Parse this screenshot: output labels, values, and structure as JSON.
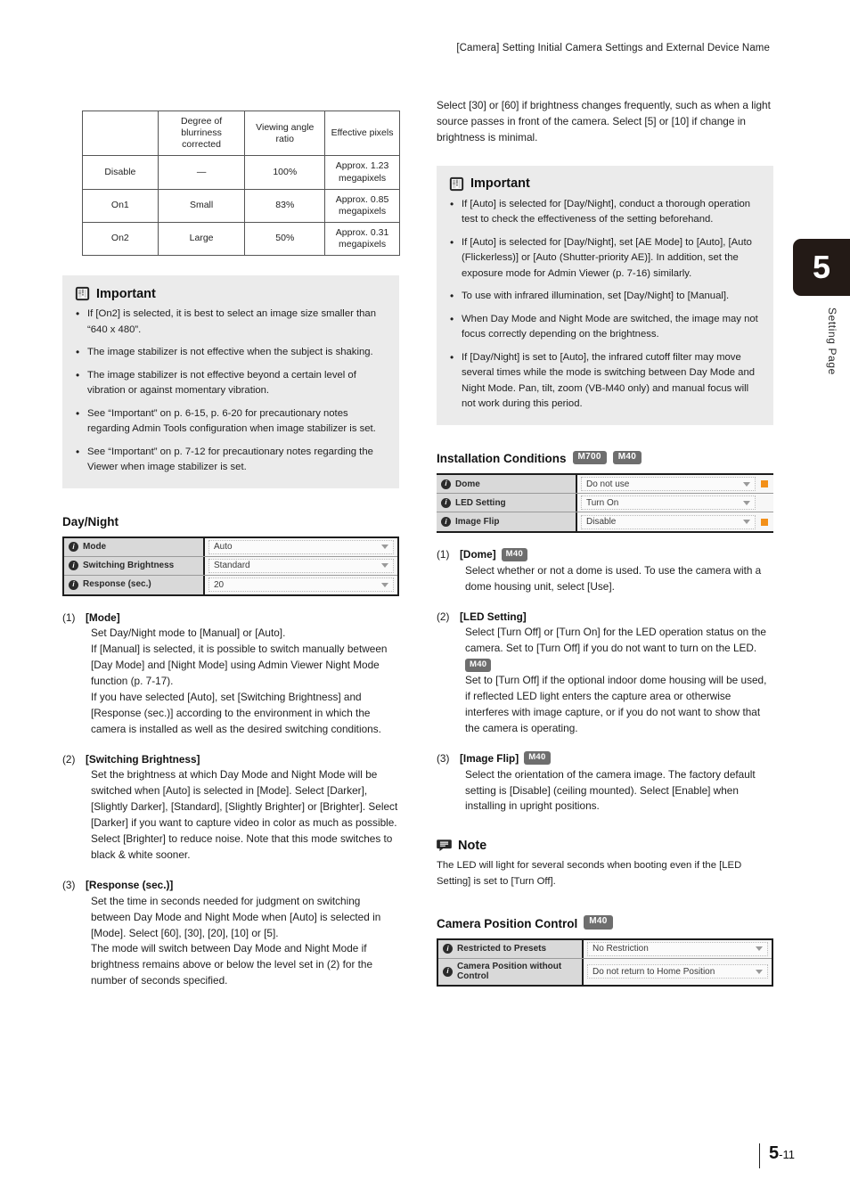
{
  "header": {
    "title": "[Camera] Setting Initial Camera Settings and External Device Name"
  },
  "side_tab": {
    "chapter": "5",
    "label": "Setting Page"
  },
  "footer": {
    "page_major": "5",
    "page_minor": "-11"
  },
  "left": {
    "spec_table": {
      "headers": [
        "",
        "Degree of blurriness corrected",
        "Viewing angle ratio",
        "Effective pixels"
      ],
      "rows": [
        [
          "Disable",
          "—",
          "100%",
          "Approx. 1.23 megapixels"
        ],
        [
          "On1",
          "Small",
          "83%",
          "Approx. 0.85 megapixels"
        ],
        [
          "On2",
          "Large",
          "50%",
          "Approx. 0.31 megapixels"
        ]
      ]
    },
    "important": {
      "title": "Important",
      "icon": "important-icon",
      "items": [
        "If [On2] is selected, it is best to select an image size smaller than “640 x 480”.",
        "The image stabilizer is not effective when the subject is shaking.",
        "The image stabilizer is not effective beyond a certain level of vibration or against momentary vibration.",
        "See “Important” on p. 6-15, p. 6-20 for precautionary notes regarding Admin Tools configuration when image stabilizer is set.",
        "See “Important” on p. 7-12 for precautionary notes regarding the Viewer when image stabilizer is set."
      ]
    },
    "daynight": {
      "heading": "Day/Night",
      "settings": [
        {
          "label": "Mode",
          "value": "Auto",
          "mark": false
        },
        {
          "label": "Switching Brightness",
          "value": "Standard",
          "mark": false
        },
        {
          "label": "Response (sec.)",
          "value": "20",
          "mark": false
        }
      ]
    },
    "items": [
      {
        "index": "(1)",
        "title": "[Mode]",
        "badge": "",
        "body": "Set Day/Night mode to [Manual] or [Auto].\nIf [Manual] is selected, it is possible to switch manually between [Day Mode] and [Night Mode] using Admin Viewer Night Mode function (p. 7-17).\nIf you have selected [Auto], set [Switching Brightness] and [Response (sec.)] according to the environment in which the camera is installed as well as the desired switching conditions."
      },
      {
        "index": "(2)",
        "title": "[Switching Brightness]",
        "badge": "",
        "body": "Set the brightness at which Day Mode and Night Mode will be switched when [Auto] is selected in [Mode]. Select [Darker], [Slightly Darker], [Standard], [Slightly Brighter] or [Brighter]. Select [Darker] if you want to capture video in color as much as possible. Select [Brighter] to reduce noise. Note that this mode switches to black & white sooner."
      },
      {
        "index": "(3)",
        "title": "[Response (sec.)]",
        "badge": "",
        "body": "Set the time in seconds needed for judgment on switching between Day Mode and Night Mode when [Auto] is selected in [Mode]. Select [60], [30], [20], [10] or [5].\nThe mode will switch between Day Mode and Night Mode if brightness remains above or below the level set in (2) for the number of seconds specified."
      }
    ]
  },
  "right": {
    "intro": "Select [30] or [60] if brightness changes frequently, such as when a light source passes in front of the camera. Select [5] or [10] if change in brightness is minimal.",
    "important": {
      "title": "Important",
      "icon": "important-icon",
      "items": [
        "If [Auto] is selected for [Day/Night], conduct a thorough operation test to check the effectiveness of the setting beforehand.",
        "If [Auto] is selected for [Day/Night], set [AE Mode] to [Auto], [Auto (Flickerless)] or [Auto (Shutter-priority AE)]. In addition, set the exposure mode for Admin Viewer (p. 7-16) similarly.",
        "To use with infrared illumination, set [Day/Night] to [Manual].",
        "When Day Mode and Night Mode are switched, the image may not focus correctly depending on the brightness.",
        "If [Day/Night] is set to [Auto], the infrared cutoff filter may move several times while the mode is switching between Day Mode and Night Mode. Pan, tilt, zoom (VB-M40 only) and manual focus will not work during this period."
      ]
    },
    "installation": {
      "heading": "Installation Conditions",
      "badges": [
        "M700",
        "M40"
      ],
      "settings": [
        {
          "label": "Dome",
          "value": "Do not use",
          "mark": true
        },
        {
          "label": "LED Setting",
          "value": "Turn On",
          "mark": false
        },
        {
          "label": "Image Flip",
          "value": "Disable",
          "mark": true
        }
      ]
    },
    "items": [
      {
        "index": "(1)",
        "title": "[Dome]",
        "badge": "M40",
        "body": "Select whether or not a dome is used. To use the camera with a dome housing unit, select [Use].",
        "sub_badge": "",
        "body2": ""
      },
      {
        "index": "(2)",
        "title": "[LED Setting]",
        "badge": "",
        "body": "Select [Turn Off] or [Turn On] for the LED operation status on the camera. Set to [Turn Off] if you do not want to turn on the LED.",
        "sub_badge": "M40",
        "body2": "Set to [Turn Off] if the optional indoor dome housing will be used, if reflected LED light enters the capture area or otherwise interferes with image capture, or if you do not want to show that the camera is operating."
      },
      {
        "index": "(3)",
        "title": "[Image Flip]",
        "badge": "M40",
        "body": "Select the orientation of the camera image. The factory default setting is [Disable] (ceiling mounted). Select [Enable] when installing in upright positions.",
        "sub_badge": "",
        "body2": ""
      }
    ],
    "note": {
      "title": "Note",
      "icon": "note-icon",
      "text": "The LED will light for several seconds when booting even if the [LED Setting] is set to [Turn Off]."
    },
    "camera_position": {
      "heading": "Camera Position Control",
      "badge": "M40",
      "settings": [
        {
          "label": "Restricted to Presets",
          "value": "No Restriction"
        },
        {
          "label": "Camera Position without Control",
          "value": "Do not return to Home Position"
        }
      ]
    }
  },
  "colors": {
    "accent_orange": "#f39019",
    "badge_gray": "#6e6e6e",
    "callout_bg": "#ebebeb",
    "tab_black": "#231a16"
  }
}
